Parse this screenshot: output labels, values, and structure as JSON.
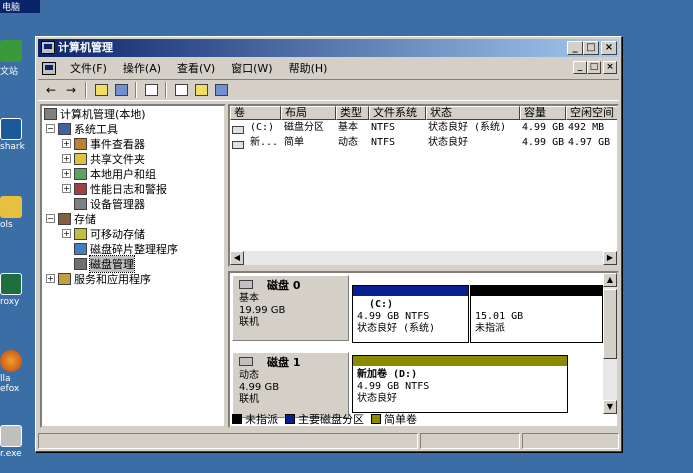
{
  "desktop": {
    "icons": [
      {
        "name": "icon-1",
        "label": "电脑"
      },
      {
        "name": "icon-2",
        "label": "文站"
      },
      {
        "name": "icon-3",
        "label": "shark"
      },
      {
        "name": "icon-4",
        "label": "ols"
      },
      {
        "name": "icon-5",
        "label": "roxy"
      },
      {
        "name": "icon-6",
        "label": "lla"
      },
      {
        "name": "icon-6b",
        "label": "efox"
      },
      {
        "name": "icon-7",
        "label": "r.exe"
      }
    ]
  },
  "window": {
    "title": "计算机管理",
    "title_buttons": {
      "minimize": "_",
      "maximize": "□",
      "close": "×"
    },
    "menus": [
      "文件(F)",
      "操作(A)",
      "查看(V)",
      "窗口(W)",
      "帮助(H)"
    ]
  },
  "toolbar": {
    "back": "←",
    "forward": "→"
  },
  "tree": {
    "items": [
      {
        "label": "计算机管理(本地)",
        "level": 0,
        "exp": ""
      },
      {
        "label": "系统工具",
        "level": 1,
        "exp": "−"
      },
      {
        "label": "事件查看器",
        "level": 2,
        "exp": "+"
      },
      {
        "label": "共享文件夹",
        "level": 2,
        "exp": "+"
      },
      {
        "label": "本地用户和组",
        "level": 2,
        "exp": "+"
      },
      {
        "label": "性能日志和警报",
        "level": 2,
        "exp": "+"
      },
      {
        "label": "设备管理器",
        "level": 2,
        "exp": ""
      },
      {
        "label": "存储",
        "level": 1,
        "exp": "−"
      },
      {
        "label": "可移动存储",
        "level": 2,
        "exp": "+"
      },
      {
        "label": "磁盘碎片整理程序",
        "level": 2,
        "exp": ""
      },
      {
        "label": "磁盘管理",
        "level": 2,
        "exp": "",
        "selected": true
      },
      {
        "label": "服务和应用程序",
        "level": 1,
        "exp": "+"
      }
    ]
  },
  "volumes": {
    "headers": [
      "卷",
      "布局",
      "类型",
      "文件系统",
      "状态",
      "容量",
      "空闲空间"
    ],
    "rows": [
      [
        "(C:)",
        "磁盘分区",
        "基本",
        "NTFS",
        "状态良好 (系统)",
        "4.99 GB",
        "492 MB"
      ],
      [
        "新...",
        "简单",
        "动态",
        "NTFS",
        "状态良好",
        "4.99 GB",
        "4.97 GB"
      ]
    ]
  },
  "disks": [
    {
      "name": "磁盘 0",
      "type": "基本",
      "size": "19.99 GB",
      "status": "联机",
      "parts": [
        {
          "title": "(C:)",
          "line1": "4.99 GB NTFS",
          "line2": "状态良好 (系统)",
          "color": "#0a1f8f"
        },
        {
          "title": "",
          "line1": "15.01 GB",
          "line2": "未指派",
          "color": "#000000"
        }
      ]
    },
    {
      "name": "磁盘 1",
      "type": "动态",
      "size": "4.99 GB",
      "status": "联机",
      "parts": [
        {
          "title": "新加卷  (D:)",
          "line1": "4.99 GB NTFS",
          "line2": "状态良好",
          "color": "#8a8a00"
        }
      ]
    }
  ],
  "legend": [
    {
      "label": "未指派",
      "color": "#000000"
    },
    {
      "label": "主要磁盘分区",
      "color": "#0a1f8f"
    },
    {
      "label": "简单卷",
      "color": "#8a8a00"
    }
  ]
}
